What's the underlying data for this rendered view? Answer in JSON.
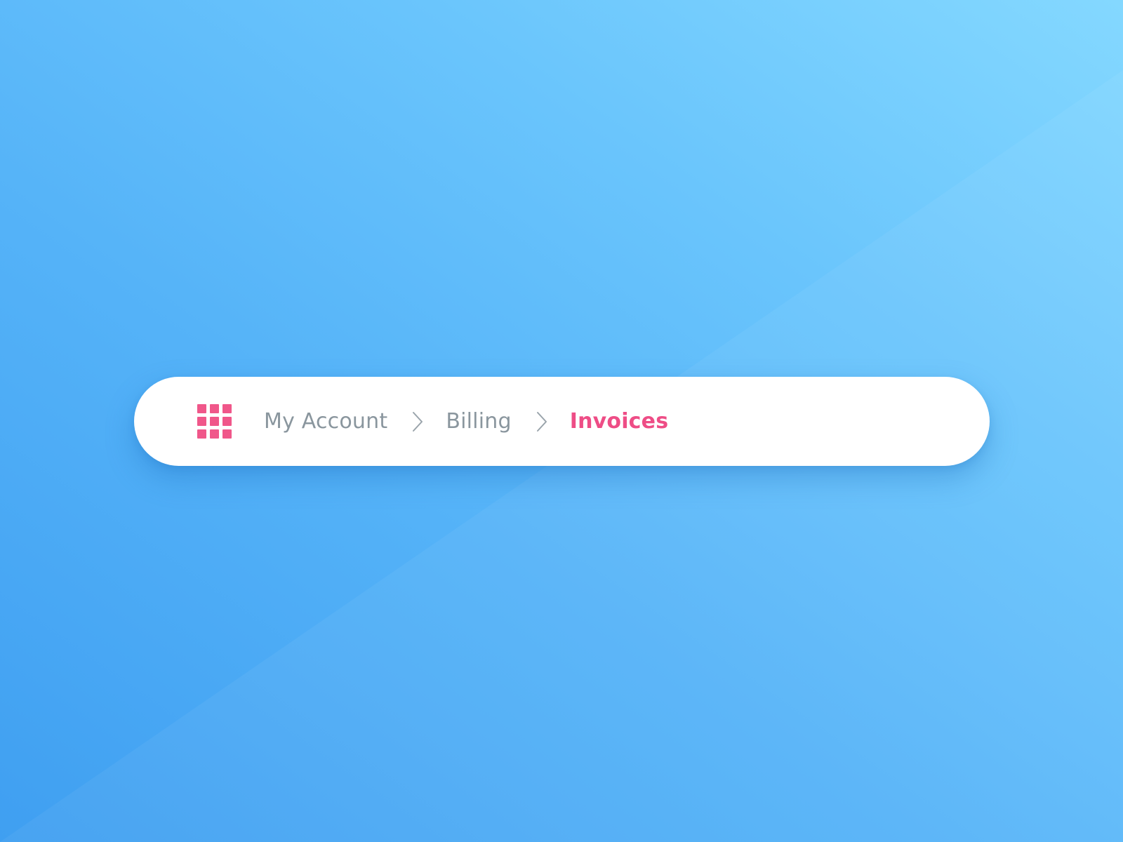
{
  "colors": {
    "accent": "#ee4d86",
    "crumb_text": "#8a969e",
    "bar_background": "#ffffff",
    "background_start": "#3f9ff1",
    "background_end": "#84d8ff"
  },
  "breadcrumb": {
    "apps_icon": "grid-icon",
    "separator_icon": "chevron-right-icon",
    "items": [
      {
        "label": "My Account",
        "current": false
      },
      {
        "label": "Billing",
        "current": false
      },
      {
        "label": "Invoices",
        "current": true
      }
    ]
  }
}
